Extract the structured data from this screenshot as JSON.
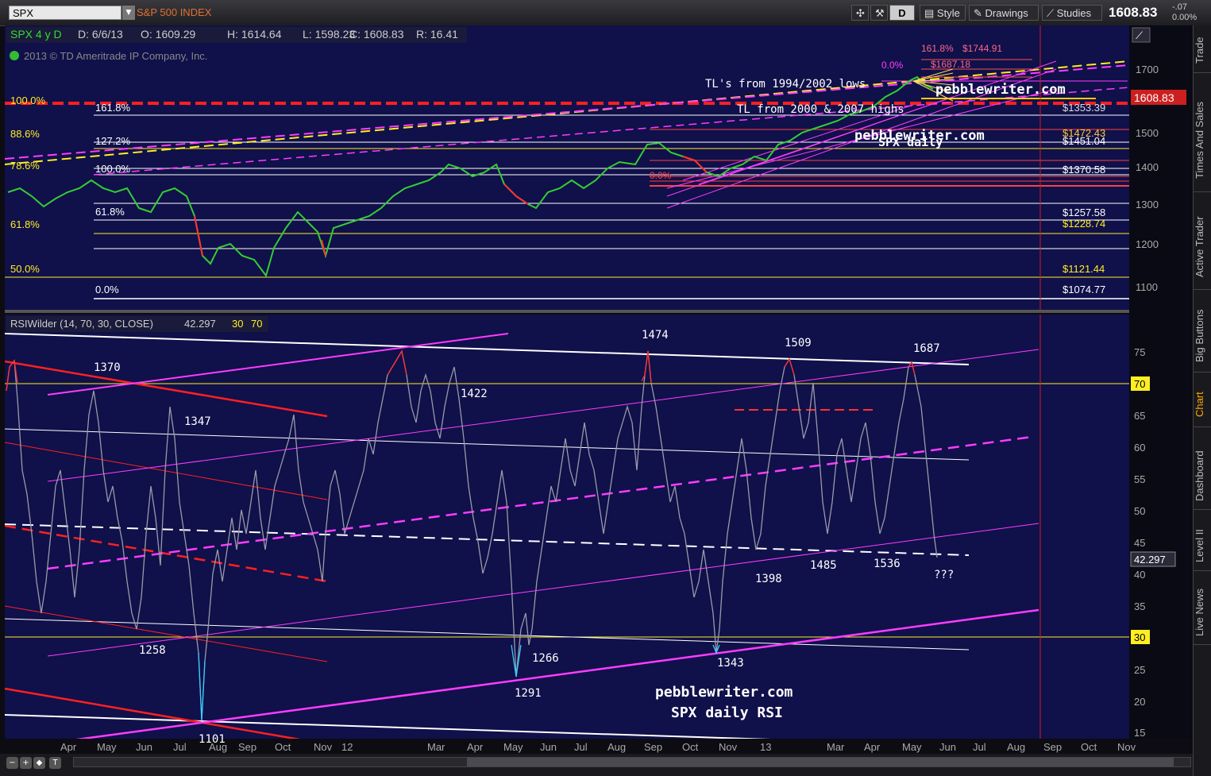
{
  "toolbar": {
    "symbol": "SPX",
    "symbol_name": "S&P 500 INDEX",
    "style_label": "Style",
    "drawings_label": "Drawings",
    "studies_label": "Studies",
    "last_price": "1608.83",
    "change": "-.07",
    "change_pct": "0.00%",
    "d_button": "D"
  },
  "price_pane": {
    "header": "SPX 4 y D",
    "date": "D: 6/6/13",
    "open": "O: 1609.29",
    "high": "H: 1614.64",
    "low": "L: 1598.23",
    "close": "C: 1608.83",
    "range": "R: 16.41",
    "copyright": "2013 © TD Ameritrade IP Company, Inc.",
    "price_marker": "1608.83",
    "y_ticks": [
      "1700",
      "1600",
      "1500",
      "1400",
      "1300",
      "1200",
      "1100"
    ],
    "left_fibs": [
      "100.0%",
      "88.6%",
      "78.6%",
      "61.8%",
      "50.0%"
    ],
    "inner_fibs": [
      "161.8%",
      "127.2%",
      "100.0%",
      "61.8%",
      "0.0%"
    ],
    "price_levels": [
      "$1451.04",
      "$1370.58",
      "$1257.58",
      "$1228.74",
      "$1121.44",
      "$1074.77",
      "$1472.43",
      "$1353.39",
      "$1744.91",
      "$1687.18"
    ],
    "upper_fibs": [
      "161.8%",
      "0.0%",
      "0.0%"
    ],
    "annotation_1": "TL's from 1994/2002 lows",
    "annotation_2": "TL from 2000 & 2007 highs",
    "watermark_1": "pebblewriter.com",
    "watermark_2": "SPX daily"
  },
  "rsi_pane": {
    "header": "RSIWilder (14, 70, 30, CLOSE)",
    "value": "42.297",
    "ob": "30",
    "os": "70",
    "marker_70": "70",
    "marker_30": "30",
    "marker_value": "42.297",
    "y_ticks": [
      "75",
      "70",
      "65",
      "60",
      "55",
      "50",
      "45",
      "40",
      "35",
      "30",
      "25",
      "20",
      "15"
    ],
    "labels": [
      "1370",
      "1347",
      "1258",
      "1101",
      "1474",
      "1422",
      "1266",
      "1291",
      "1509",
      "1343",
      "1398",
      "1485",
      "1536",
      "1687",
      "???"
    ],
    "watermark_1": "pebblewriter.com",
    "watermark_2": "SPX daily RSI"
  },
  "x_axis": [
    "Apr",
    "May",
    "Jun",
    "Jul",
    "Aug",
    "Sep",
    "Oct",
    "Nov",
    "12",
    "Mar",
    "Apr",
    "May",
    "Jun",
    "Jul",
    "Aug",
    "Sep",
    "Oct",
    "Nov",
    "13",
    "Mar",
    "Apr",
    "May",
    "Jun",
    "Jul",
    "Aug",
    "Sep",
    "Oct",
    "Nov"
  ],
  "right_tabs": [
    "Trade",
    "Times And Sales",
    "Active Trader",
    "Big Buttons",
    "Chart",
    "Dashboard",
    "Level II",
    "Live News"
  ],
  "colors": {
    "background": "#10104a",
    "rsi_line": "#a0a0a8",
    "magenta": "#ff3cff",
    "fib_yellow": "#ffee22",
    "red": "#ff2020"
  }
}
